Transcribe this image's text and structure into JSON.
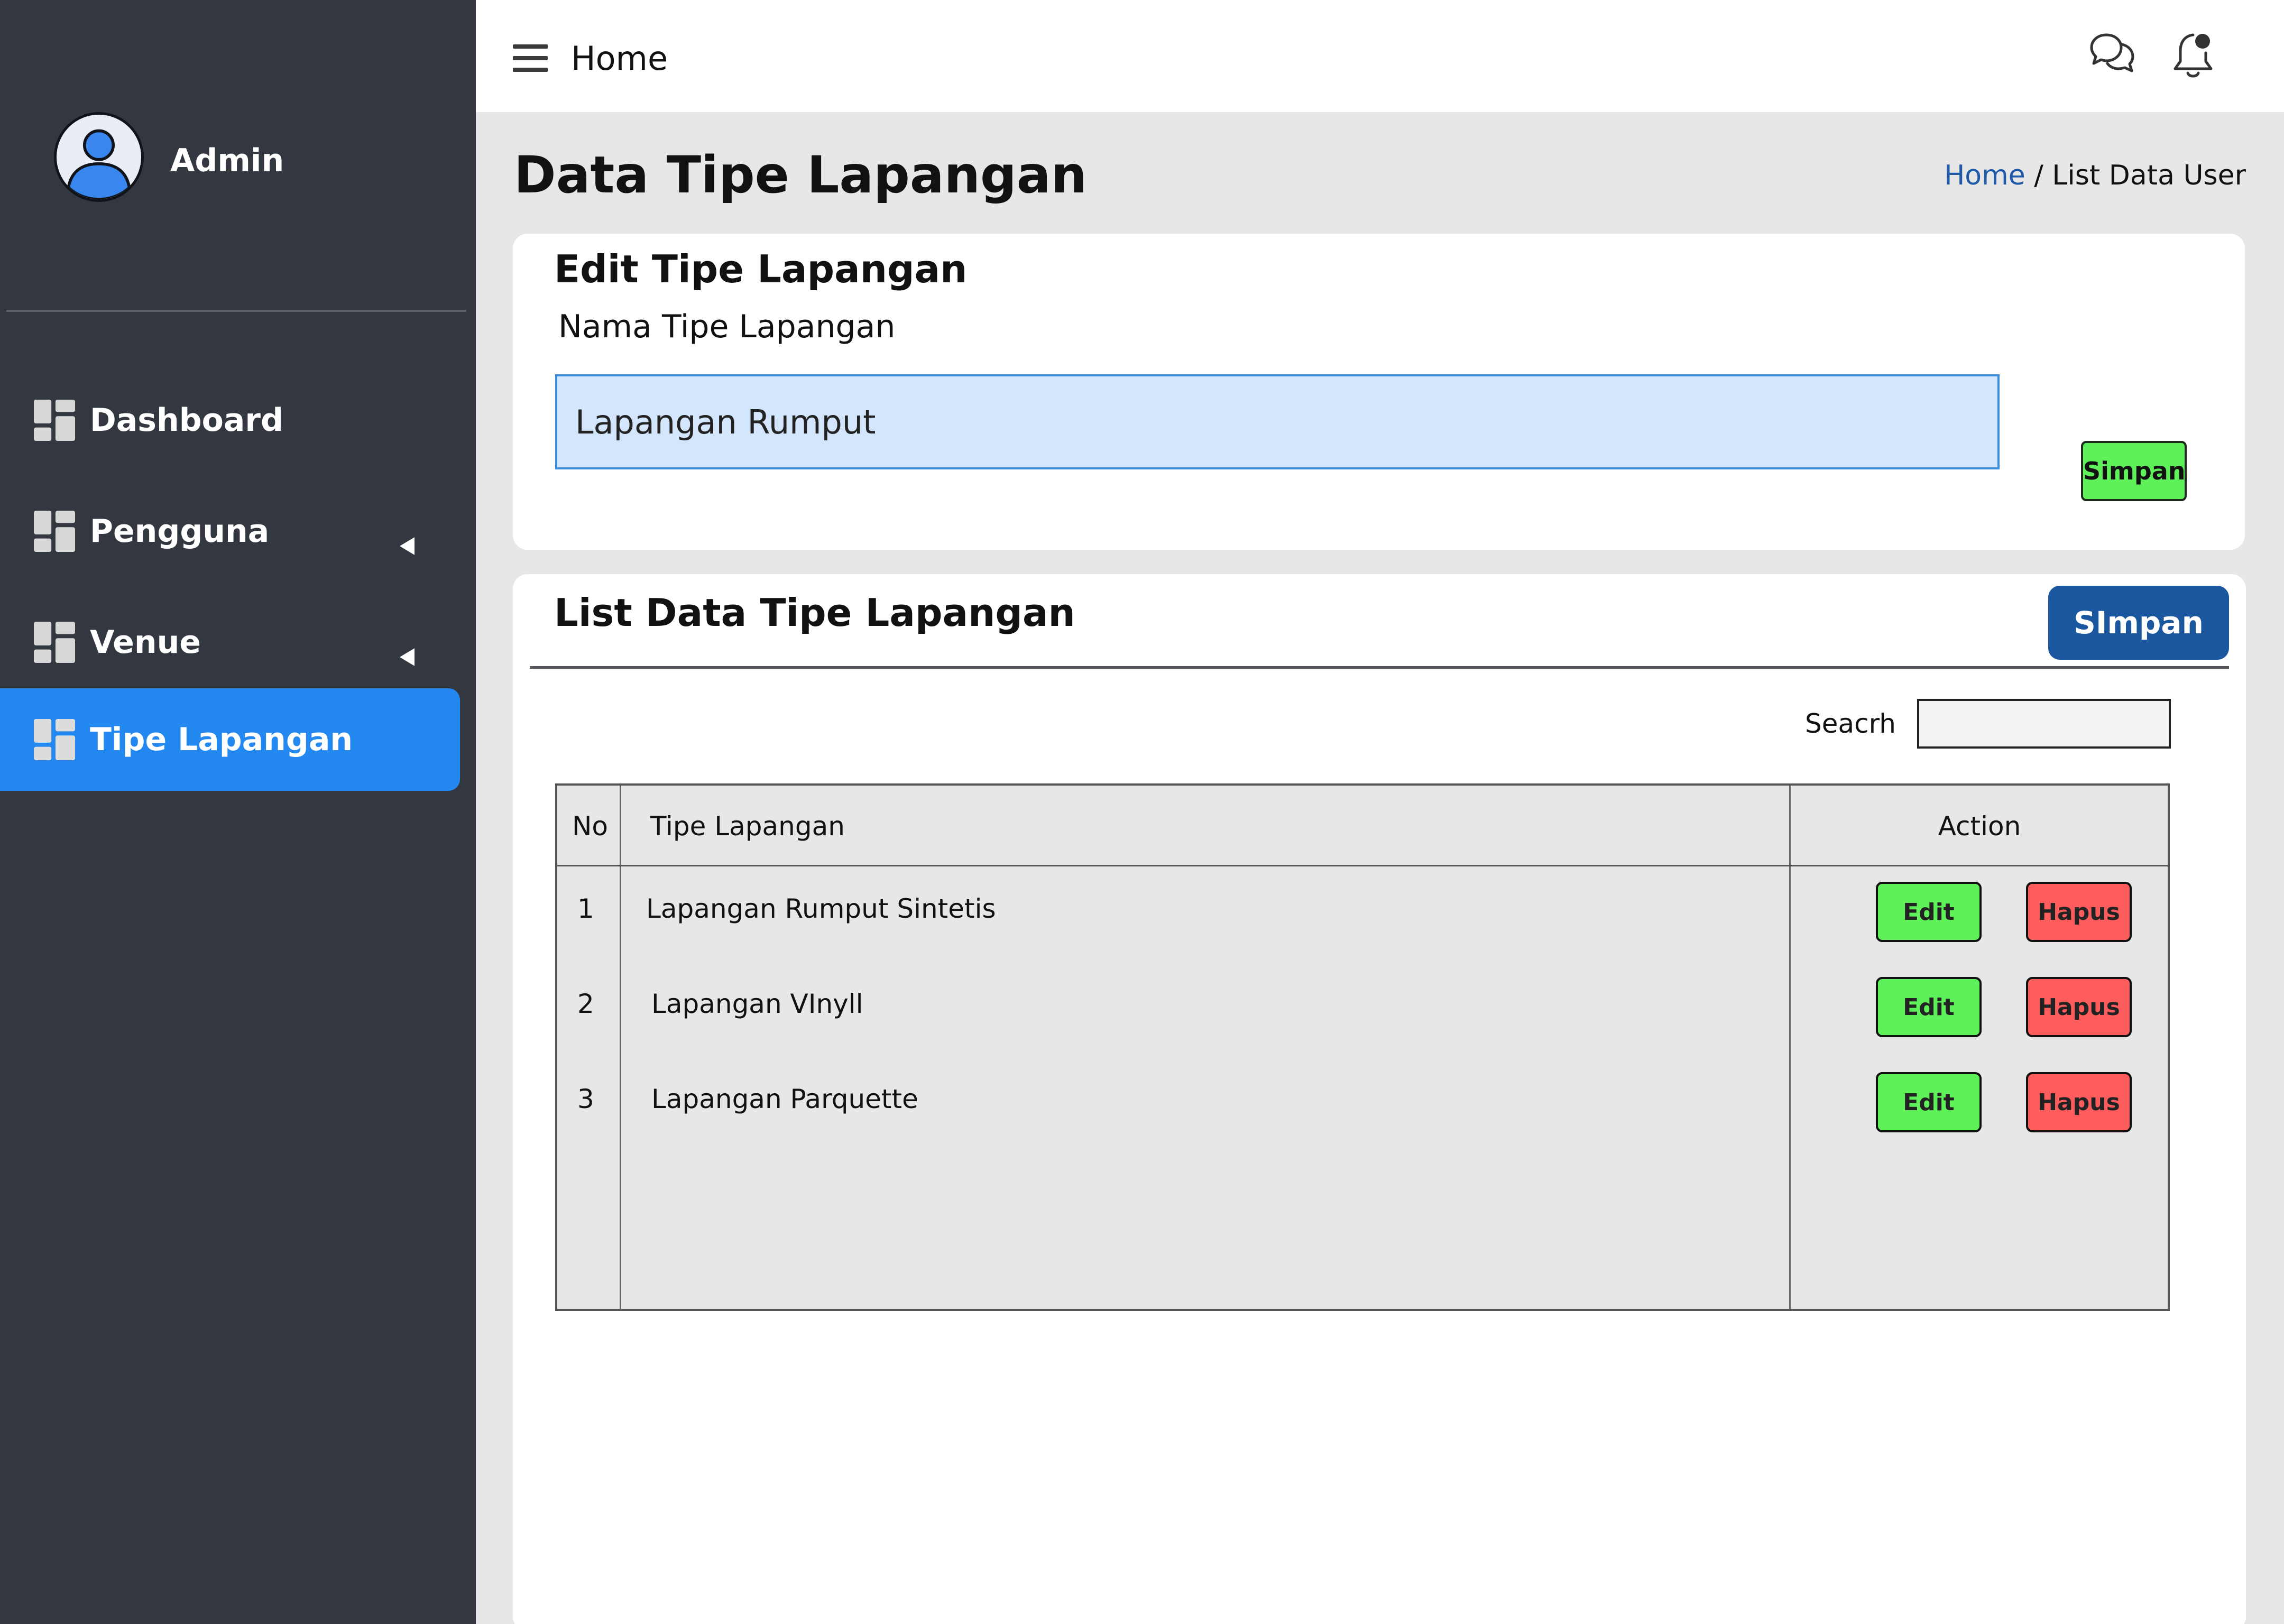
{
  "user": {
    "name": "Admin"
  },
  "sidebar": {
    "items": [
      {
        "label": "Dashboard",
        "has_submenu": false,
        "active": false
      },
      {
        "label": "Pengguna",
        "has_submenu": true,
        "active": false
      },
      {
        "label": "Venue",
        "has_submenu": true,
        "active": false
      },
      {
        "label": "Tipe Lapangan",
        "has_submenu": false,
        "active": true
      }
    ]
  },
  "topbar": {
    "title": "Home"
  },
  "page": {
    "title": "Data Tipe Lapangan",
    "breadcrumb": {
      "home": "Home",
      "separator": "/",
      "current": "List Data User"
    }
  },
  "edit_card": {
    "title": "Edit Tipe Lapangan",
    "field_label": "Nama Tipe Lapangan",
    "field_value": "Lapangan Rumput",
    "save_label": "Simpan"
  },
  "list_card": {
    "title": "List Data Tipe Lapangan",
    "save_label": "SImpan",
    "search_label": "Seacrh",
    "search_value": "",
    "table": {
      "headers": {
        "no": "No",
        "type": "Tipe Lapangan",
        "action": "Action"
      },
      "rows": [
        {
          "no": "1",
          "type": "Lapangan Rumput Sintetis",
          "edit": "Edit",
          "delete": "Hapus"
        },
        {
          "no": "2",
          "type": "Lapangan VInyll",
          "edit": "Edit",
          "delete": "Hapus"
        },
        {
          "no": "3",
          "type": "Lapangan Parquette",
          "edit": "Edit",
          "delete": "Hapus"
        }
      ]
    }
  },
  "colors": {
    "sidebar_bg": "#323740",
    "active_nav": "#2388f0",
    "primary_button": "#1b579e",
    "edit_button": "#5ff15a",
    "delete_button": "#fc5c5c",
    "input_bg": "#d3e6fb",
    "link": "#1e5aa8"
  },
  "icons": {
    "menu": "hamburger-icon",
    "chat": "chat-icon",
    "notification": "bell-icon",
    "nav": "dashboard-grid-icon",
    "submenu": "caret-left-icon",
    "avatar": "user-avatar-icon"
  }
}
